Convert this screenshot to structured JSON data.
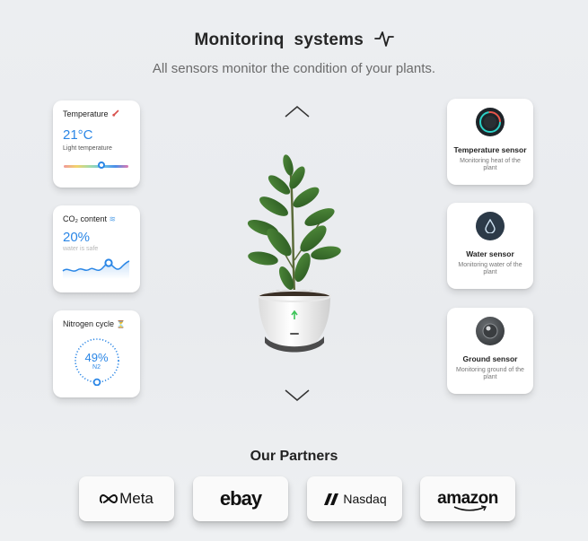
{
  "header": {
    "title": "Monitorinq  systems",
    "subtitle": "All sensors monitor the condition of your plants."
  },
  "left_cards": {
    "temperature": {
      "title": "Temperature",
      "value": "21°C",
      "sub": "Light temperature",
      "level": 0.6
    },
    "co2": {
      "title": "CO₂ content",
      "value": "20%",
      "sub": "water is safe"
    },
    "nitrogen": {
      "title": "Nitrogen cycle",
      "value": "49%",
      "unit": "N2",
      "level": 0.49
    }
  },
  "right_cards": [
    {
      "name": "Temperature sensor",
      "desc": "Monitoring heat of the plant",
      "icon": "temperature-sensor-icon"
    },
    {
      "name": "Water sensor",
      "desc": "Monitoring water of the plant",
      "icon": "water-drop-icon"
    },
    {
      "name": "Ground sensor",
      "desc": "Monitoring ground of the plant",
      "icon": "ground-sensor-icon"
    }
  ],
  "partners": {
    "title": "Our Partners",
    "logos": [
      "Meta",
      "ebay",
      "Nasdaq",
      "amazon"
    ]
  },
  "colors": {
    "accent": "#2a86e6"
  }
}
